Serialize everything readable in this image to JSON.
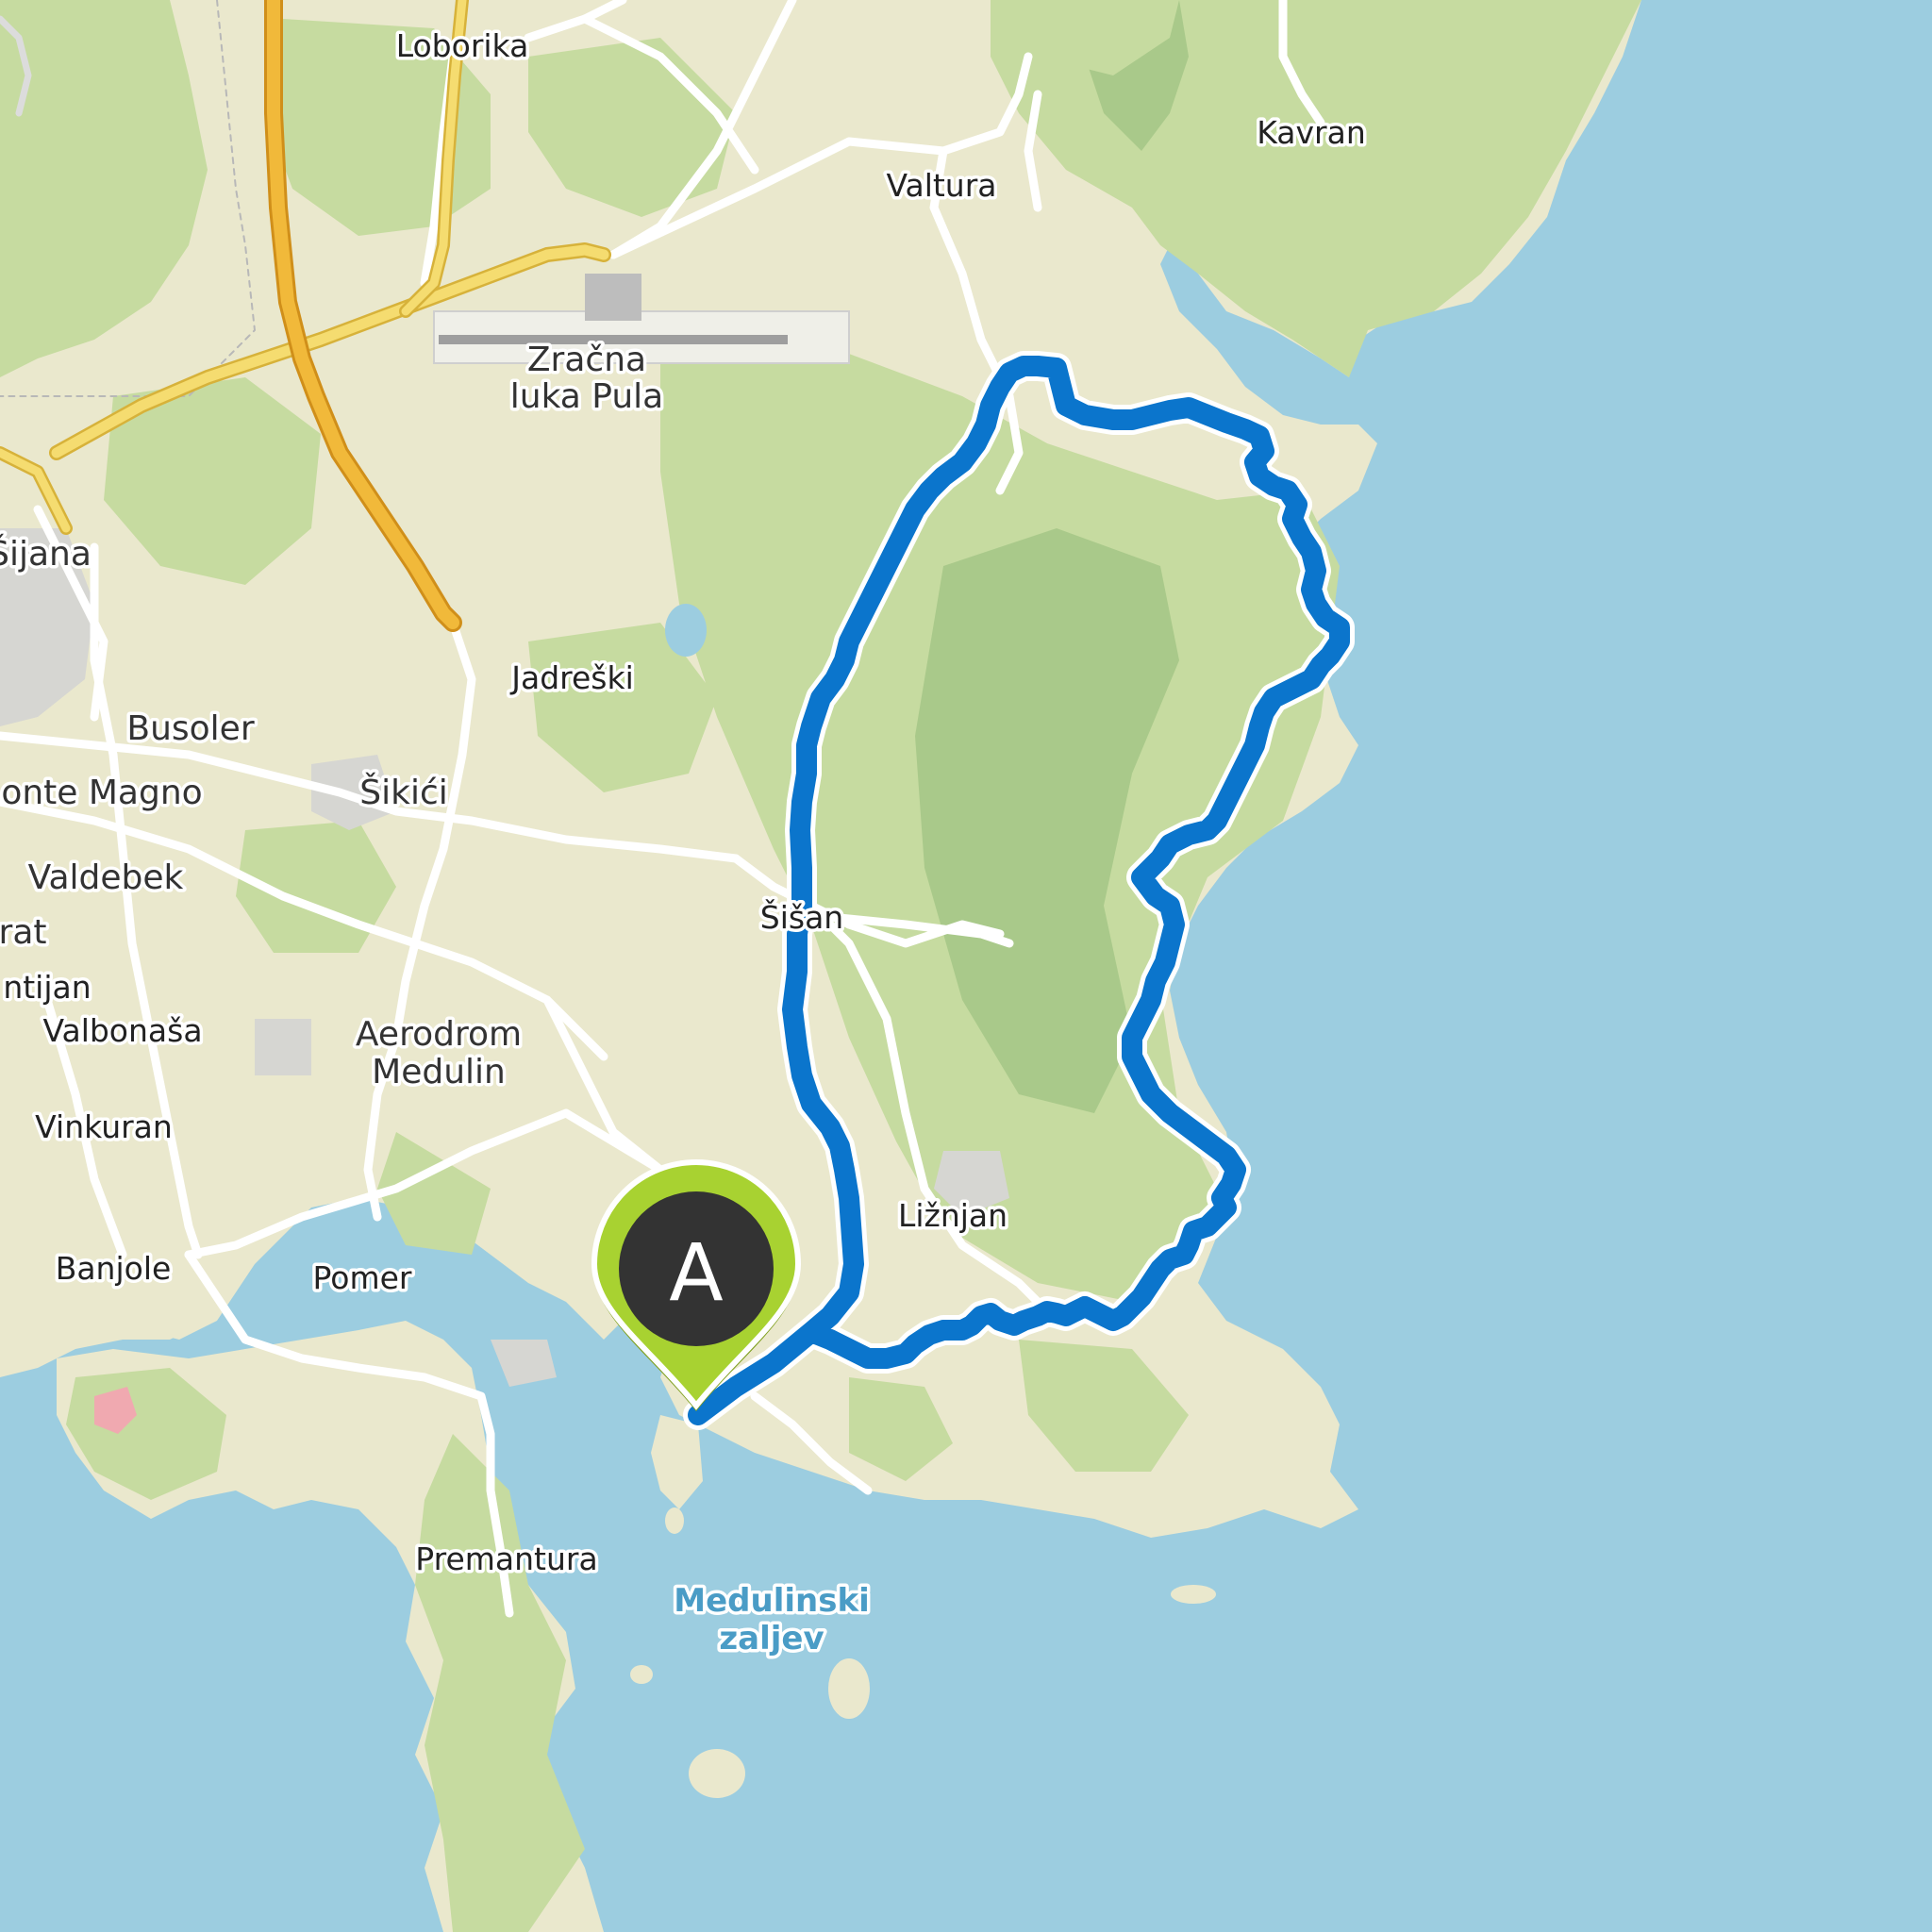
{
  "map": {
    "colors": {
      "sea": "#9ccde0",
      "land": "#eae8cd",
      "forest": "#c6dba0",
      "forest_dark": "#a9c98a",
      "route": "#0b75cc",
      "marker": "#a8d231",
      "highway": "#f1b93a",
      "main_road": "#f5dc70"
    },
    "labels": {
      "loborika": "Loborika",
      "kavran": "Kavran",
      "valtura": "Valtura",
      "zracna_1": "Zračna",
      "zracna_2": "luka Pula",
      "sijana": "Šijana",
      "jadreski": "Jadreški",
      "busoler": "Busoler",
      "monte_magno": "onte Magno",
      "sikici": "Šikići",
      "valdebek": "Valdebek",
      "rat": "rat",
      "ntijan": "ntijan",
      "valbonasa": "Valbonaša",
      "sisan": "Šišan",
      "aerodrom_1": "Aerodrom",
      "aerodrom_2": "Medulin",
      "vinkuran": "Vinkuran",
      "liznjan": "Ližnjan",
      "banjole": "Banjole",
      "pomer": "Pomer",
      "premantura": "Premantura",
      "bay_1": "Medulinski",
      "bay_2": "zaljev"
    },
    "marker": {
      "letter": "A",
      "icon": "map-pin-icon"
    }
  }
}
